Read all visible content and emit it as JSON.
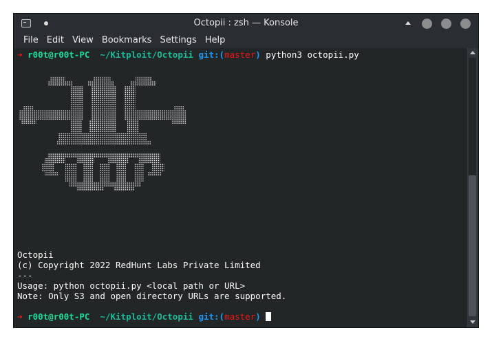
{
  "window": {
    "title": "Octopii : zsh — Konsole"
  },
  "menu": [
    "File",
    "Edit",
    "View",
    "Bookmarks",
    "Settings",
    "Help"
  ],
  "prompt": {
    "arrow": "➜",
    "user": "r00t@r00t-PC",
    "path": "~/Kitploit/Octopii",
    "git_label": "git:",
    "paren_open": "(",
    "branch": "master",
    "paren_close": ")"
  },
  "first_command": "python3 octopii.py",
  "output": {
    "name": "Octopii",
    "copyright": "(c) Copyright 2022 RedHunt Labs Private Limited",
    "separator": "---",
    "usage": "Usage: python octopii.py <local path or URL>",
    "note": "Note: Only S3 and open directory URLs are supported."
  },
  "icons": {
    "app": "konsole-terminal-icon",
    "pin": "pin-dot-icon",
    "keep_above": "chevron-up-icon",
    "minimize": "minimize-icon",
    "maximize": "maximize-icon",
    "close": "close-icon"
  },
  "colors": {
    "background": "#232627",
    "prompt_arrow": "#ed1515",
    "prompt_user": "#1cdc9a",
    "prompt_git": "#1d99f3",
    "text": "#fcfcfc"
  }
}
